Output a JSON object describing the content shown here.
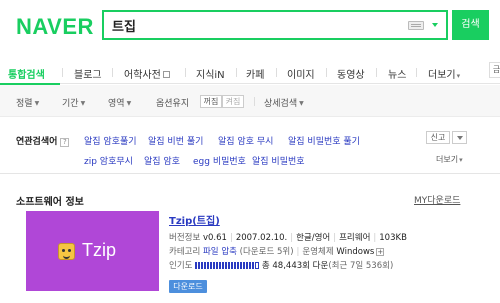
{
  "header": {
    "logo": "NAVER",
    "search_value": "트집",
    "search_button": "검색"
  },
  "nav": {
    "tabs": [
      {
        "label": "통합검색",
        "active": true
      },
      {
        "label": "블로그"
      },
      {
        "label": "어학사전"
      },
      {
        "label": "지식iN"
      },
      {
        "label": "카페"
      },
      {
        "label": "이미지"
      },
      {
        "label": "동영상"
      },
      {
        "label": "뉴스"
      },
      {
        "label": "더보기"
      }
    ],
    "right_box": "금"
  },
  "options": {
    "sort": "정렬",
    "period": "기간",
    "area": "영역",
    "option_keep": "옵션유지",
    "keep_on": "꺼짐",
    "keep_off": "켜짐",
    "detail": "상세검색"
  },
  "related": {
    "title": "연관검색어",
    "help": "?",
    "links_row1": [
      "알집 암호풀기",
      "알집 비번 풀기",
      "알집 암호 무시",
      "알집 비밀번호 풀기"
    ],
    "links_row2": [
      "zip 암호무시",
      "알집 암호",
      "egg 비밀번호",
      "알집 비밀번호"
    ],
    "report": "신고",
    "more": "더보기"
  },
  "software": {
    "section_title": "소프트웨어 정보",
    "my_download": "MY다운로드",
    "thumb_label": "Tzip",
    "name": "Tzip(트집)",
    "version_label": "버전정보",
    "version": "v0.61",
    "date": "2007.02.10.",
    "language": "한글/영어",
    "license": "프리웨어",
    "size": "103KB",
    "category_label": "카테고리",
    "category": "파일 압축",
    "category_count": "(다운로드 5위)",
    "os_label": "운영체제",
    "os": "Windows",
    "os_more": "+",
    "popularity_label": "인기도",
    "total_downloads": "총 48,443회 다운",
    "recent_downloads": "(최근 7일 536회)",
    "popularity_level": 0.93,
    "download_button": "다운로드"
  }
}
